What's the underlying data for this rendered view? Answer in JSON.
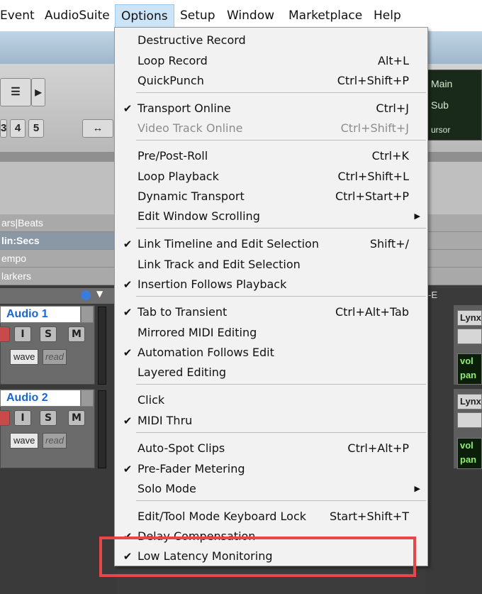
{
  "menubar": {
    "items": [
      "Event",
      "AudioSuite",
      "Options",
      "Setup",
      "Window",
      "Marketplace",
      "Help"
    ]
  },
  "background": {
    "rulers": [
      "ars|Beats",
      "lin:Secs",
      "empo",
      "larkers"
    ],
    "tracks": [
      {
        "name": "Audio 1",
        "buttons": [
          "I",
          "S",
          "M"
        ],
        "wave": "wave",
        "read": "read"
      },
      {
        "name": "Audio 2",
        "buttons": [
          "I",
          "S",
          "M"
        ],
        "wave": "wave",
        "read": "read"
      }
    ],
    "toolbar_numbers": [
      "3",
      "4",
      "5"
    ],
    "counter_labels": [
      "Main",
      "Sub",
      "ursor"
    ],
    "right_col_header": "-E",
    "right_panel": {
      "output": "Lynx",
      "vol": "vol",
      "pan": "pan"
    }
  },
  "menu": {
    "groups": [
      [
        {
          "label": "Destructive Record",
          "shortcut": "",
          "checked": false,
          "disabled": false
        },
        {
          "label": "Loop Record",
          "shortcut": "Alt+L",
          "checked": false,
          "disabled": false
        },
        {
          "label": "QuickPunch",
          "shortcut": "Ctrl+Shift+P",
          "checked": false,
          "disabled": false
        }
      ],
      [
        {
          "label": "Transport Online",
          "shortcut": "Ctrl+J",
          "checked": true,
          "disabled": false
        },
        {
          "label": "Video Track Online",
          "shortcut": "Ctrl+Shift+J",
          "checked": false,
          "disabled": true
        }
      ],
      [
        {
          "label": "Pre/Post-Roll",
          "shortcut": "Ctrl+K",
          "checked": false,
          "disabled": false
        },
        {
          "label": "Loop Playback",
          "shortcut": "Ctrl+Shift+L",
          "checked": false,
          "disabled": false
        },
        {
          "label": "Dynamic Transport",
          "shortcut": "Ctrl+Start+P",
          "checked": false,
          "disabled": false
        },
        {
          "label": "Edit Window Scrolling",
          "shortcut": "",
          "checked": false,
          "disabled": false,
          "submenu": true
        }
      ],
      [
        {
          "label": "Link Timeline and Edit Selection",
          "shortcut": "Shift+/",
          "checked": true,
          "disabled": false
        },
        {
          "label": "Link Track and Edit Selection",
          "shortcut": "",
          "checked": false,
          "disabled": false
        },
        {
          "label": "Insertion Follows Playback",
          "shortcut": "",
          "checked": true,
          "disabled": false
        }
      ],
      [
        {
          "label": "Tab to Transient",
          "shortcut": "Ctrl+Alt+Tab",
          "checked": true,
          "disabled": false
        },
        {
          "label": "Mirrored MIDI Editing",
          "shortcut": "",
          "checked": false,
          "disabled": false
        },
        {
          "label": "Automation Follows Edit",
          "shortcut": "",
          "checked": true,
          "disabled": false
        },
        {
          "label": "Layered Editing",
          "shortcut": "",
          "checked": false,
          "disabled": false
        }
      ],
      [
        {
          "label": "Click",
          "shortcut": "",
          "checked": false,
          "disabled": false
        },
        {
          "label": "MIDI Thru",
          "shortcut": "",
          "checked": true,
          "disabled": false
        }
      ],
      [
        {
          "label": "Auto-Spot Clips",
          "shortcut": "Ctrl+Alt+P",
          "checked": false,
          "disabled": false
        },
        {
          "label": "Pre-Fader Metering",
          "shortcut": "",
          "checked": true,
          "disabled": false
        },
        {
          "label": "Solo Mode",
          "shortcut": "",
          "checked": false,
          "disabled": false,
          "submenu": true
        }
      ],
      [
        {
          "label": "Edit/Tool Mode Keyboard Lock",
          "shortcut": "Start+Shift+T",
          "checked": false,
          "disabled": false
        },
        {
          "label": "Delay Compensation",
          "shortcut": "",
          "checked": true,
          "disabled": false
        },
        {
          "label": "Low Latency Monitoring",
          "shortcut": "",
          "checked": true,
          "disabled": false
        }
      ]
    ],
    "check_glyph": "✔",
    "submenu_glyph": "▶"
  },
  "colors": {
    "highlight_box": "#e8474a",
    "menu_open_bg": "#cce4f7",
    "track_name": "#1865d6"
  }
}
